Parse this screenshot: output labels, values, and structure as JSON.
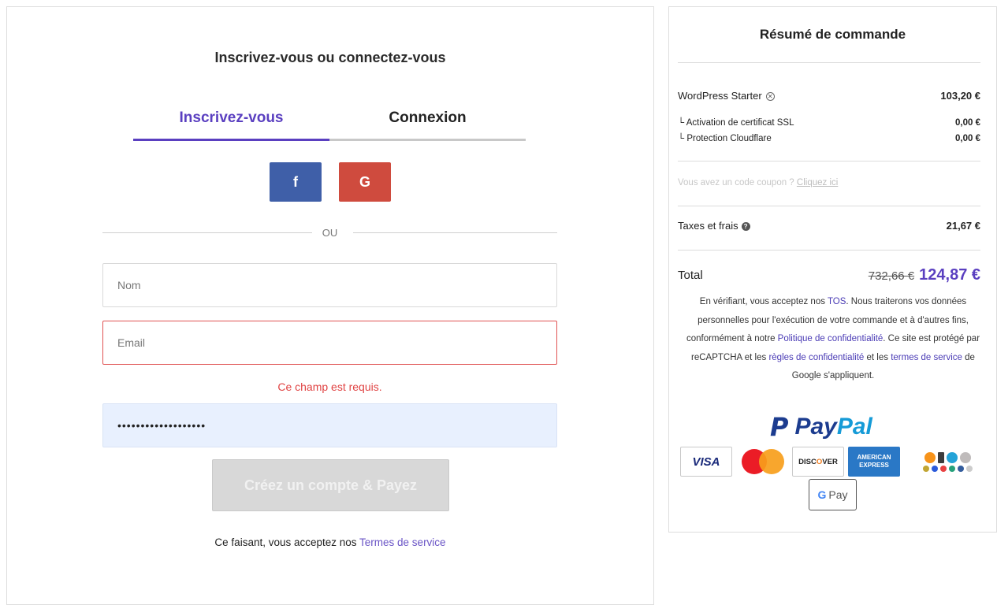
{
  "auth": {
    "title": "Inscrivez-vous ou connectez-vous",
    "tabs": [
      {
        "label": "Inscrivez-vous",
        "active": true
      },
      {
        "label": "Connexion",
        "active": false
      }
    ],
    "social": {
      "facebook_icon": "f",
      "google_icon": "G",
      "facebook_color": "#3f5fa8",
      "google_color": "#cf4b3e"
    },
    "divider_text": "OU",
    "fields": {
      "name_placeholder": "Nom",
      "email_placeholder": "Email",
      "email_error": "Ce champ est requis.",
      "password_value": "•••••••••••••••••••"
    },
    "submit_label": "Créez un compte & Payez",
    "agree_text": "Ce faisant, vous acceptez nos ",
    "agree_link": "Termes de service"
  },
  "summary": {
    "title": "Résumé de commande",
    "product": {
      "name": "WordPress Starter",
      "price": "103,20 €"
    },
    "addons": [
      {
        "name": "└ Activation de certificat SSL",
        "price": "0,00 €"
      },
      {
        "name": "└ Protection Cloudflare",
        "price": "0,00 €"
      }
    ],
    "coupon_text": "Vous avez un code coupon ? ",
    "coupon_link": "Cliquez ici",
    "taxes": {
      "label": "Taxes et frais",
      "value": "21,67 €"
    },
    "total": {
      "label": "Total",
      "old_price": "732,66 €",
      "new_price": "124,87 €"
    },
    "legal": {
      "p1": "En vérifiant, vous acceptez nos ",
      "tos": "TOS",
      "p2": ". Nous traiterons vos données personnelles pour l'exécution de votre commande et à d'autres fins, conformément à notre ",
      "privacy": "Politique de confidentialité",
      "p3": ". Ce site est protégé par reCAPTCHA et les ",
      "rules": "règles de confidentialité",
      "p4": " et les ",
      "terms": "termes de service",
      "p5": " de Google s'appliquent."
    },
    "payment": {
      "paypal_p": "P",
      "paypal_a": "Pay",
      "paypal_b": "Pal",
      "visa": "VISA",
      "discover": "DISC",
      "discover_o": "O",
      "discover_end": "VER",
      "amex": "AMERICAN EXPRESS",
      "gpay_g": "G",
      "gpay_text": "Pay"
    }
  }
}
